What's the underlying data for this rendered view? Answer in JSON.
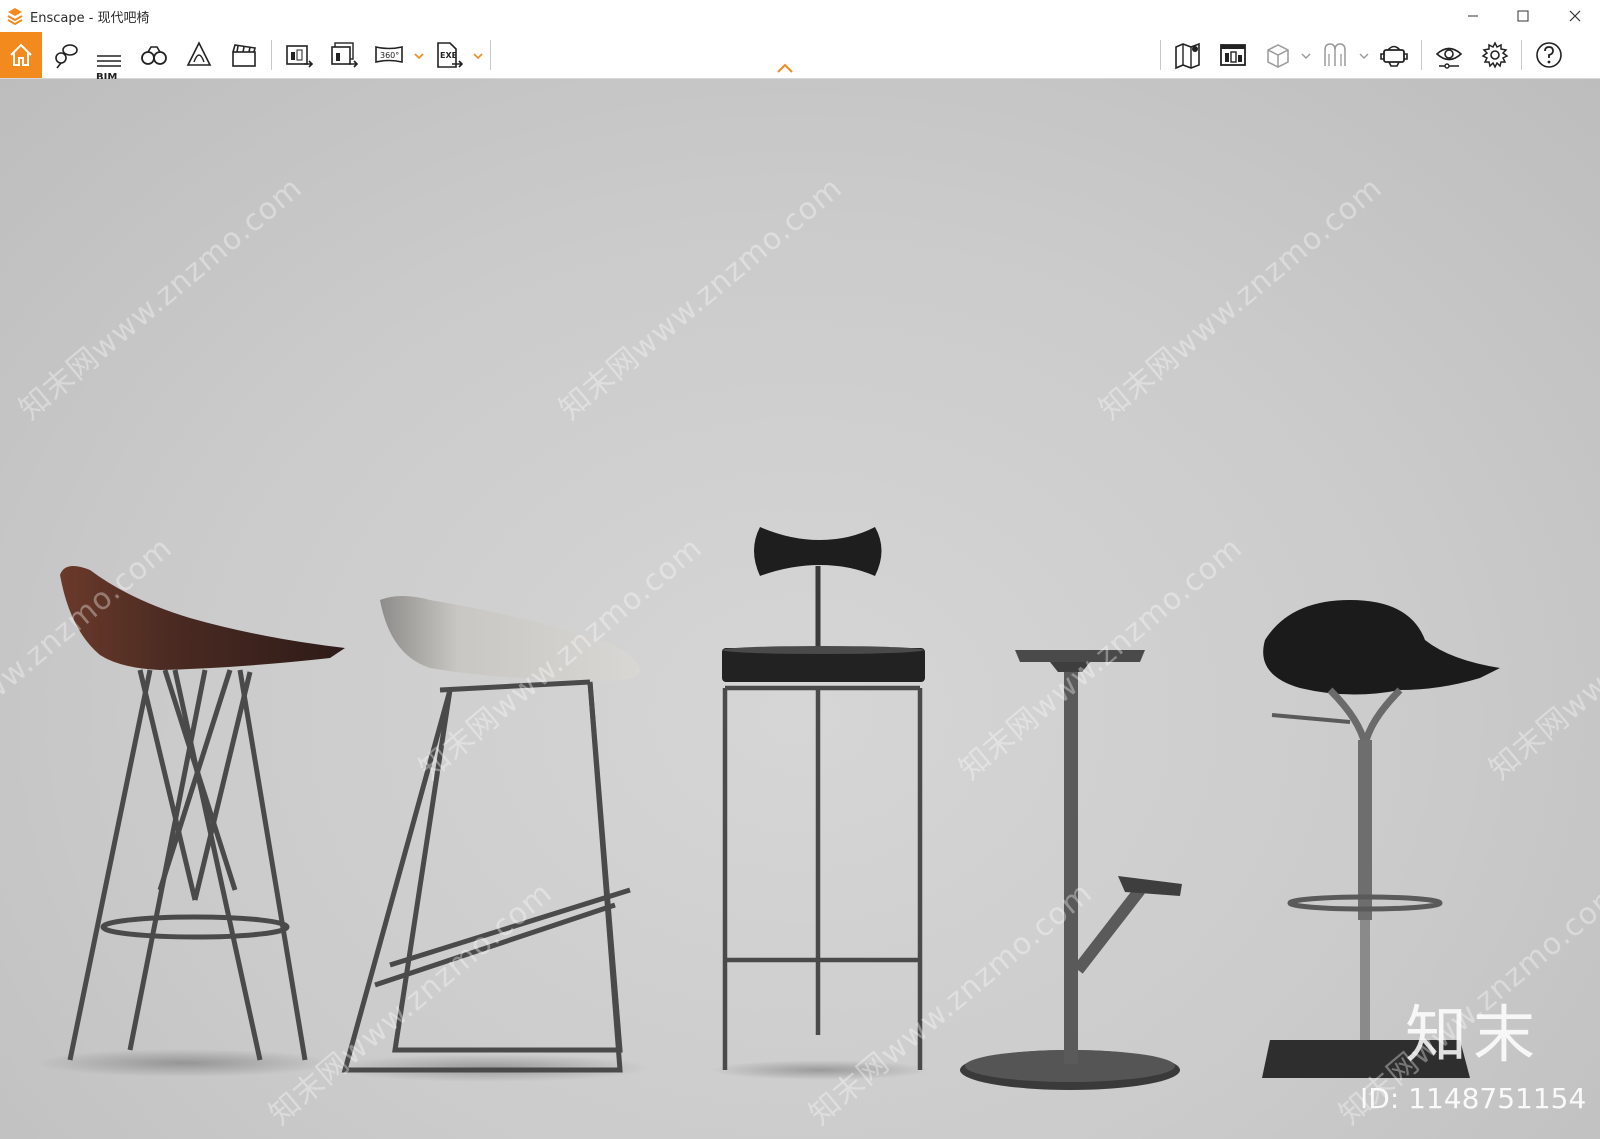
{
  "window": {
    "title": "Enscape - 现代吧椅",
    "controls": [
      "minimize-icon",
      "maximize-icon",
      "close-icon"
    ]
  },
  "toolbar": {
    "accent_color": "#f28a1e",
    "bim_label": "BIM",
    "left_icons": [
      "home-icon",
      "location-chat-icon",
      "bim-icon",
      "binoculars-icon",
      "bell-icon",
      "clapperboard-icon",
      "export-image-icon",
      "batch-export-icon",
      "panorama-360-icon",
      "export-exe-icon"
    ],
    "panorama_label": "360°",
    "exe_label": "EXE",
    "center_icon": "collapse-chevron-up-icon",
    "right_icons": [
      "map-icon",
      "asset-library-icon",
      "cube-icon",
      "light-view-icon",
      "vr-headset-icon",
      "visibility-eye-icon",
      "settings-gear-icon",
      "help-icon"
    ]
  },
  "viewport": {
    "watermark_text": "知末网www.znzmo.com",
    "brand_text": "知末",
    "id_text": "ID: 1148751154"
  }
}
